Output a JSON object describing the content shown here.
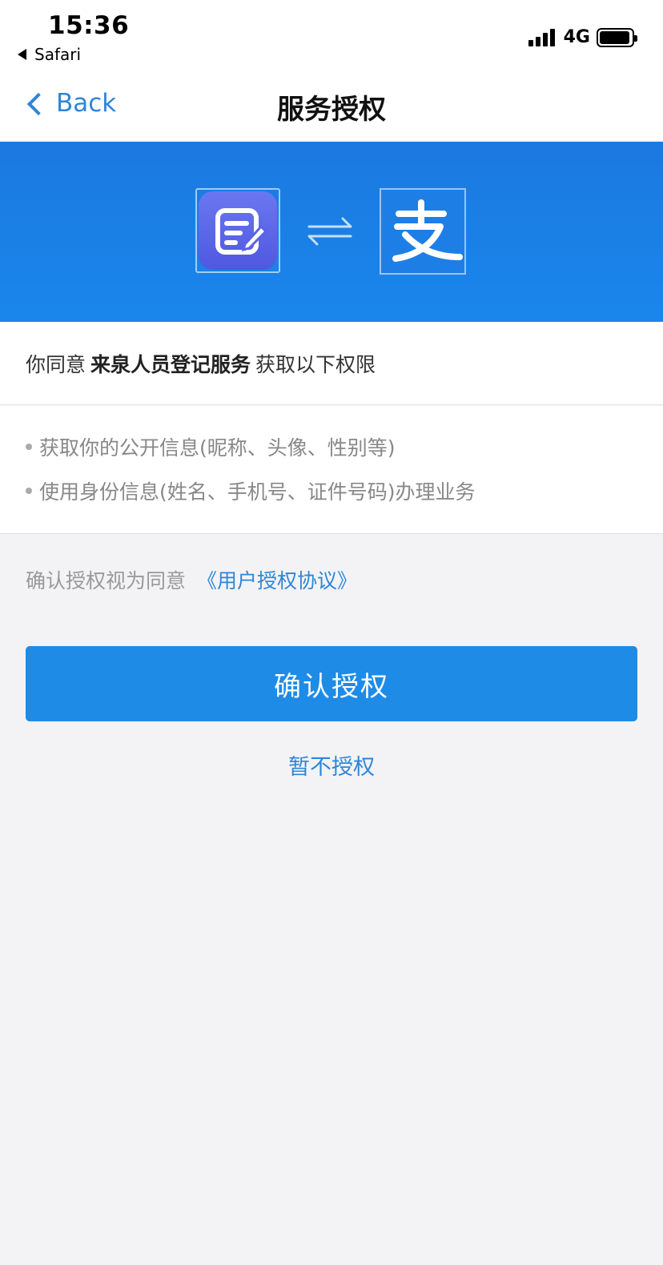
{
  "status_bar": {
    "time": "15:36",
    "back_app": "Safari",
    "network": "4G"
  },
  "nav": {
    "back_label": "Back",
    "title": "服务授权"
  },
  "banner": {
    "alipay_glyph": "支",
    "colors": {
      "background": "#1a80e6",
      "app_icon": "#5a63e6"
    }
  },
  "consent": {
    "prefix": "你同意",
    "service_name": "来泉人员登记服务",
    "suffix": "获取以下权限"
  },
  "permissions": [
    "获取你的公开信息(昵称、头像、性别等)",
    "使用身份信息(姓名、手机号、证件号码)办理业务"
  ],
  "agreement": {
    "prefix": "确认授权视为同意",
    "link_label": "《用户授权协议》"
  },
  "actions": {
    "confirm_label": "确认授权",
    "decline_label": "暂不授权"
  },
  "colors": {
    "accent": "#1e8be6",
    "link": "#2f86d8"
  }
}
